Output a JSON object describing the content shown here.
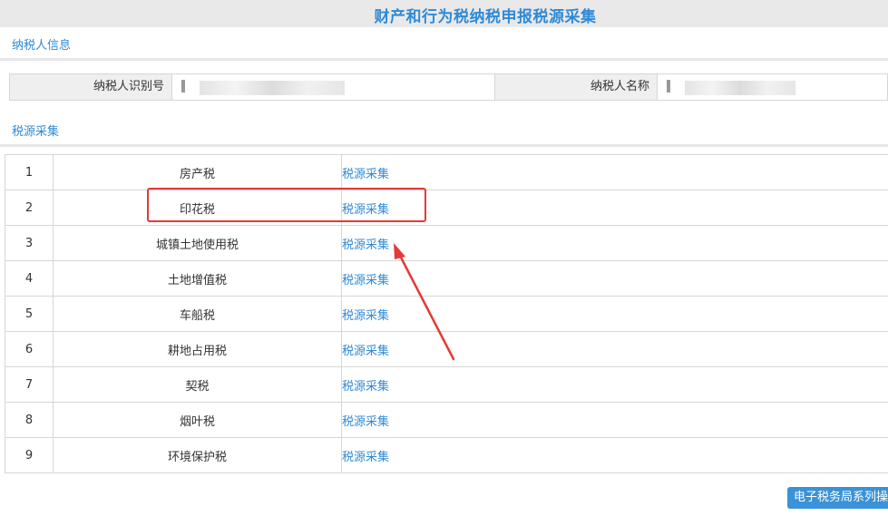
{
  "header": {
    "title": "财产和行为税纳税申报税源采集"
  },
  "taxpayer_section": {
    "tab_label": "纳税人信息",
    "id_label": "纳税人识别号",
    "name_label": "纳税人名称"
  },
  "tax_source_section": {
    "tab_label": "税源采集",
    "rows": [
      {
        "no": "1",
        "name": "房产税",
        "action": "税源采集"
      },
      {
        "no": "2",
        "name": "印花税",
        "action": "税源采集"
      },
      {
        "no": "3",
        "name": "城镇土地使用税",
        "action": "税源采集"
      },
      {
        "no": "4",
        "name": "土地增值税",
        "action": "税源采集"
      },
      {
        "no": "5",
        "name": "车船税",
        "action": "税源采集"
      },
      {
        "no": "6",
        "name": "耕地占用税",
        "action": "税源采集"
      },
      {
        "no": "7",
        "name": "契税",
        "action": "税源采集"
      },
      {
        "no": "8",
        "name": "烟叶税",
        "action": "税源采集"
      },
      {
        "no": "9",
        "name": "环境保护税",
        "action": "税源采集"
      }
    ]
  },
  "footer": {
    "manual_button": "电子税务局系列操作手册"
  },
  "colors": {
    "accent": "#2f8ad6",
    "highlight": "#e53935"
  }
}
